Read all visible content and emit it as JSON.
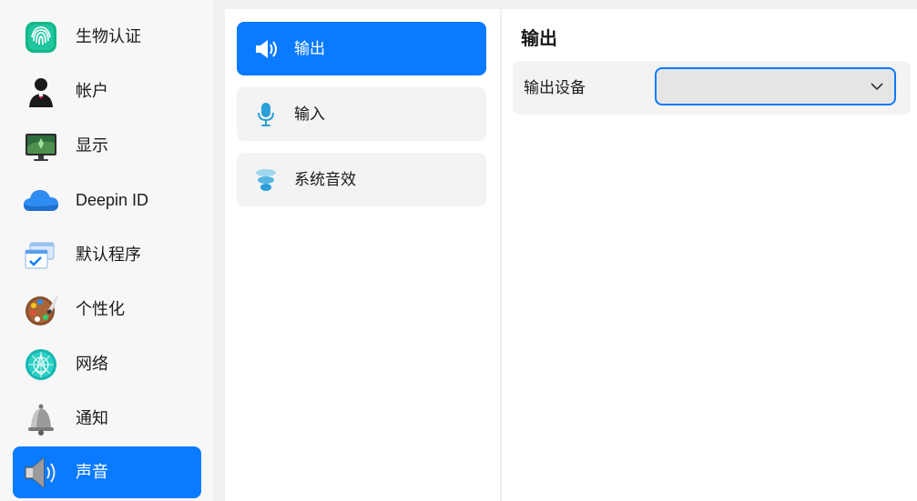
{
  "sidebar": {
    "items": [
      {
        "label": "生物认证",
        "icon": "fingerprint-icon"
      },
      {
        "label": "帐户",
        "icon": "account-user-icon"
      },
      {
        "label": "显示",
        "icon": "display-monitor-icon"
      },
      {
        "label": "Deepin ID",
        "icon": "cloud-icon"
      },
      {
        "label": "默认程序",
        "icon": "default-apps-icon"
      },
      {
        "label": "个性化",
        "icon": "palette-icon"
      },
      {
        "label": "网络",
        "icon": "network-globe-icon"
      },
      {
        "label": "通知",
        "icon": "bell-icon"
      },
      {
        "label": "声音",
        "icon": "speaker-icon",
        "active": true
      }
    ]
  },
  "sound_nav": {
    "items": [
      {
        "label": "输出",
        "icon": "speaker-output-icon",
        "active": true
      },
      {
        "label": "输入",
        "icon": "microphone-icon"
      },
      {
        "label": "系统音效",
        "icon": "sound-effects-icon"
      }
    ]
  },
  "output": {
    "title": "输出",
    "device_label": "输出设备",
    "device_value": ""
  },
  "colors": {
    "accent": "#0a7aff",
    "panel_bg": "#ffffff",
    "item_bg": "#f3f3f3"
  }
}
